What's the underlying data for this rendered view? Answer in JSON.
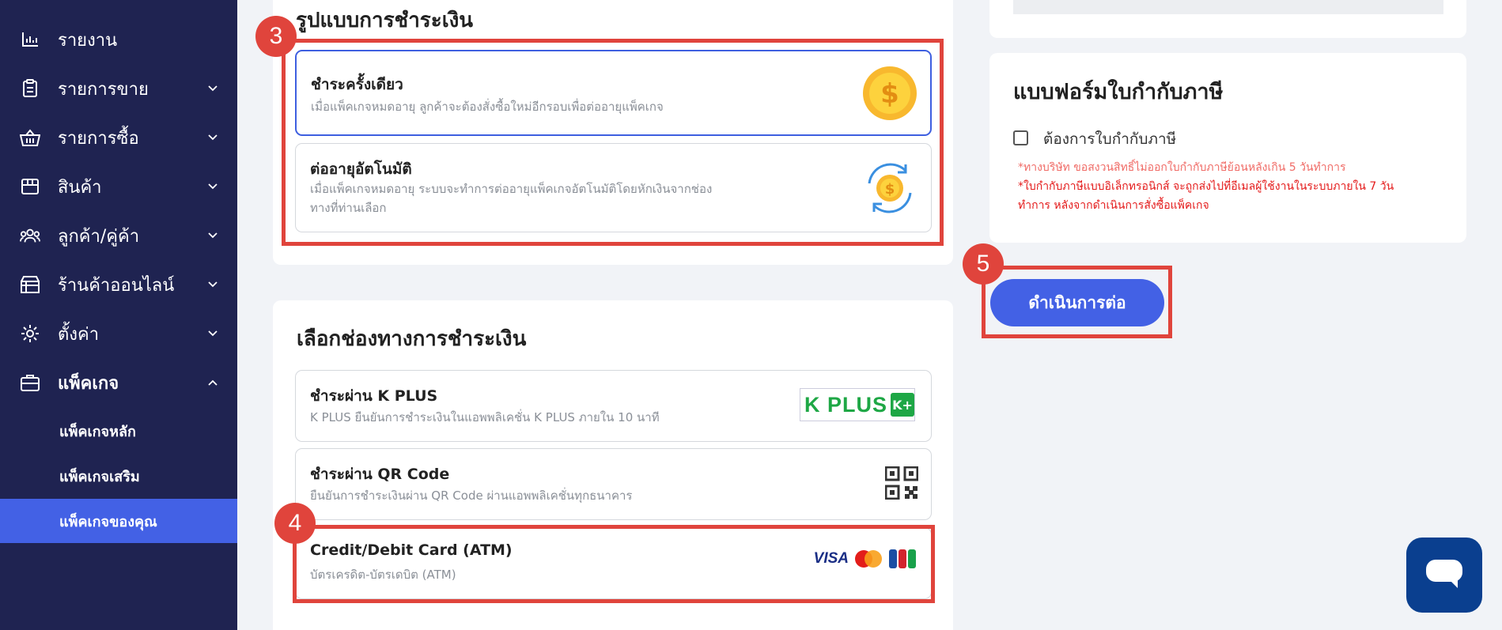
{
  "sidebar": {
    "items": [
      {
        "label": "รายงาน",
        "icon": "bar-chart-icon"
      },
      {
        "label": "รายการขาย",
        "icon": "clipboard-icon"
      },
      {
        "label": "รายการซื้อ",
        "icon": "basket-icon"
      },
      {
        "label": "สินค้า",
        "icon": "box-icon"
      },
      {
        "label": "ลูกค้า/คู่ค้า",
        "icon": "users-icon"
      },
      {
        "label": "ร้านค้าออนไลน์",
        "icon": "store-icon"
      },
      {
        "label": "ตั้งค่า",
        "icon": "gear-icon"
      },
      {
        "label": "แพ็คเกจ",
        "icon": "briefcase-icon"
      }
    ],
    "sub_items": [
      {
        "label": "แพ็คเกจหลัก"
      },
      {
        "label": "แพ็คเกจเสริม"
      },
      {
        "label": "แพ็คเกจของคุณ"
      }
    ]
  },
  "payment_type": {
    "title": "รูปแบบการชำระเงิน",
    "options": [
      {
        "title": "ชำระครั้งเดียว",
        "desc": "เมื่อแพ็คเกจหมดอายุ ลูกค้าจะต้องสั่งซื้อใหม่อีกรอบเพื่อต่ออายุแพ็คเกจ",
        "icon": "dollar-coin-icon"
      },
      {
        "title": "ต่ออายุอัตโนมัติ",
        "desc_line1": "เมื่อแพ็คเกจหมดอายุ ระบบจะทำการต่ออายุแพ็คเกจอัตโนมัติโดยหักเงินจากช่อง",
        "desc_line2": "ทางที่ท่านเลือก",
        "icon": "recurring-coin-icon"
      }
    ]
  },
  "payment_channel": {
    "title": "เลือกช่องทางการชำระเงิน",
    "options": [
      {
        "title": "ชำระผ่าน K PLUS",
        "desc": "K PLUS ยืนยันการชำระเงินในแอพพลิเคชั่น K PLUS ภายใน 10 นาที",
        "logo_text": "K PLUS",
        "logo_badge": "K+",
        "icon": "kplus-logo"
      },
      {
        "title": "ชำระผ่าน QR Code",
        "desc": "ยืนยันการชำระเงินผ่าน QR Code ผ่านแอพพลิเคชั่นทุกธนาคาร",
        "icon": "qr-code-icon"
      },
      {
        "title": "Credit/Debit Card (ATM)",
        "desc": "บัตรเครดิต-บัตรเดบิต (ATM)",
        "logos": [
          "VISA",
          "MasterCard",
          "JCB"
        ]
      }
    ]
  },
  "tax_invoice": {
    "title": "แบบฟอร์มใบกำกับภาษี",
    "checkbox_label": "ต้องการใบกำกับภาษี",
    "note1": "*ทางบริษัท ขอสงวนสิทธิ์ไม่ออกใบกำกับภาษีย้อนหลังเกิน 5 วันทำการ",
    "note2_line1": "*ใบกำกับภาษีแบบอิเล็กทรอนิกส์ จะถูกส่งไปที่อีเมลผู้ใช้งานในระบบภายใน 7 วัน",
    "note2_line2": "ทำการ หลังจากดำเนินการสั่งซื้อแพ็คเกจ"
  },
  "continue_button": "ดำเนินการต่อ",
  "badges": [
    "3",
    "4",
    "5"
  ],
  "colors": {
    "sidebar": "#1f2351",
    "accent": "#4361e5",
    "highlight": "#e0443c",
    "chat": "#0a3f8f"
  }
}
